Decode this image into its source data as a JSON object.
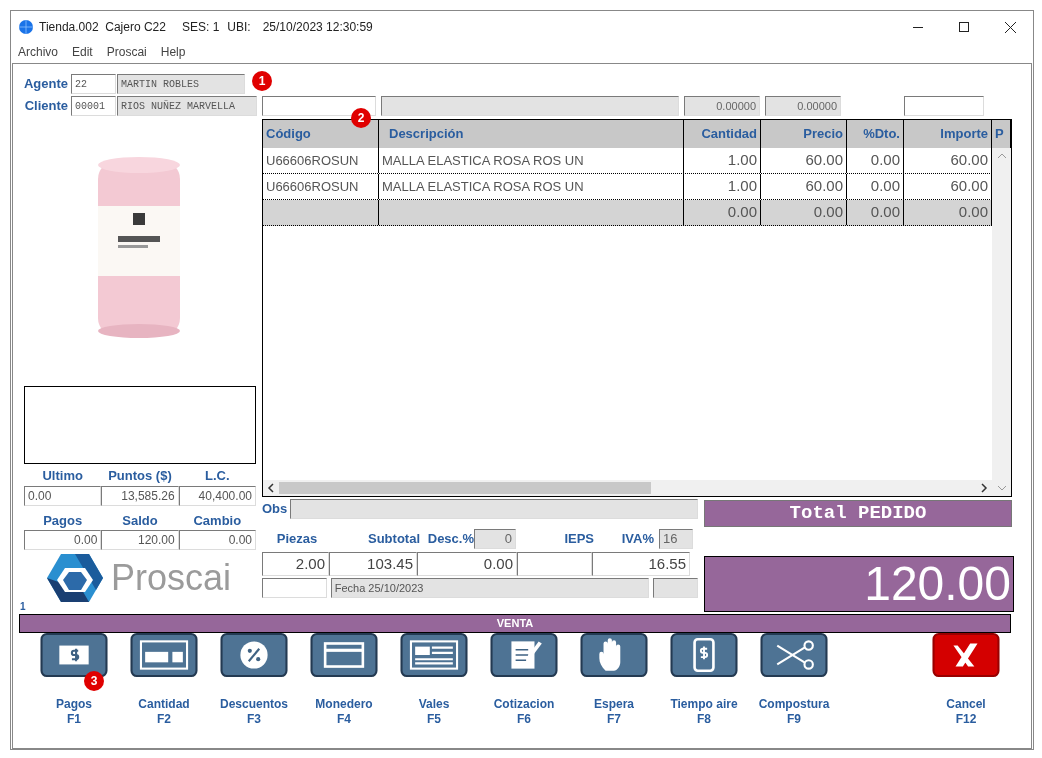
{
  "window": {
    "title": "Tienda.002  Cajero C22",
    "session": "SES: 1",
    "location": "UBI:",
    "datetime": "25/10/2023 12:30:59"
  },
  "menu": [
    "Archivo",
    "Edit",
    "Proscai",
    "Help"
  ],
  "agent": {
    "label": "Agente",
    "code": "22",
    "name": "MARTIN ROBLES",
    "badge": "1"
  },
  "client": {
    "label": "Cliente",
    "code": "00001",
    "name": "RIOS NUÑEZ MARVELLA"
  },
  "search_row": {
    "value_1": "0.00000",
    "value_2": "0.00000"
  },
  "table": {
    "badge": "2",
    "columns": [
      "Código",
      "Descripción",
      "Cantidad",
      "Precio",
      "%Dto.",
      "Importe",
      "P"
    ],
    "rows": [
      {
        "kind": "item",
        "cells": [
          "U66606ROSUN",
          "MALLA ELASTICA ROSA ROS UN",
          "1.00",
          "60.00",
          "0.00",
          "60.00"
        ]
      },
      {
        "kind": "item",
        "cells": [
          "U66606ROSUN",
          "MALLA ELASTICA ROSA ROS UN",
          "1.00",
          "60.00",
          "0.00",
          "60.00"
        ]
      },
      {
        "kind": "total",
        "cells": [
          "",
          "",
          "0.00",
          "0.00",
          "0.00",
          "0.00"
        ]
      }
    ]
  },
  "customer_stats": [
    {
      "label": "Ultimo",
      "value": "0.00"
    },
    {
      "label": "Puntos ($)",
      "value": "13,585.26"
    },
    {
      "label": "L.C.",
      "value": "40,400.00"
    }
  ],
  "payment_stats": [
    {
      "label": "Pagos",
      "value": "0.00"
    },
    {
      "label": "Saldo",
      "value": "120.00"
    },
    {
      "label": "Cambio",
      "value": "0.00"
    }
  ],
  "logo": {
    "text": "Proscai"
  },
  "page_number": "1",
  "obs": {
    "label": "Obs"
  },
  "totals": {
    "pieces_label": "Piezas",
    "pieces": "2.00",
    "subtotal_label": "Subtotal",
    "subtotal": "103.45",
    "discount_label": "Desc.%",
    "discount_pct": "0",
    "discount": "0.00",
    "ieps_label": "IEPS",
    "iva_label": "IVA%",
    "iva_pct": "16",
    "iva": "16.55",
    "date": "Fecha 25/10/2023"
  },
  "total_panel": {
    "title": "Total PEDIDO",
    "amount": "120.00"
  },
  "mode": "VENTA",
  "buttons": [
    {
      "kind": "cash",
      "label": "Pagos",
      "key": "F1",
      "badge": "3"
    },
    {
      "kind": "calculator",
      "label": "Cantidad",
      "key": "F2"
    },
    {
      "kind": "percent",
      "label": "Descuentos",
      "key": "F3"
    },
    {
      "kind": "card",
      "label": "Monedero",
      "key": "F4"
    },
    {
      "kind": "voucher",
      "label": "Vales",
      "key": "F5"
    },
    {
      "kind": "note",
      "label": "Cotizacion",
      "key": "F6"
    },
    {
      "kind": "hand",
      "label": "Espera",
      "key": "F7"
    },
    {
      "kind": "phone",
      "label": "Tiempo aire",
      "key": "F8"
    },
    {
      "kind": "scissors",
      "label": "Compostura",
      "key": "F9"
    },
    {
      "kind": "cancel",
      "label": "Cancel",
      "key": "F12"
    }
  ]
}
